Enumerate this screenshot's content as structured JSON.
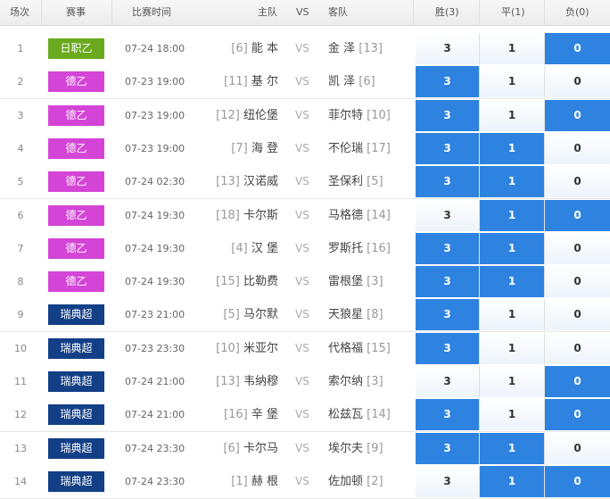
{
  "header": {
    "num": "场次",
    "league": "赛事",
    "time": "比赛时间",
    "home": "主队",
    "vs": "VS",
    "away": "客队",
    "win": "胜(3)",
    "draw": "平(1)",
    "lose": "负(0)"
  },
  "colors": {
    "j2": "#6aaa1e",
    "bundesliga2": "#d444d6",
    "allsvenskan": "#123f86",
    "selected_odd": "#2e83e0"
  },
  "rows": [
    {
      "num": "1",
      "league": "日职乙",
      "league_key": "j2",
      "time": "07-24 18:00",
      "home_rank": "[6]",
      "home": "能 本",
      "vs": "VS",
      "away": "金 泽",
      "away_rank": "[13]",
      "o3": "3",
      "o1": "1",
      "o0": "0",
      "sel": [
        false,
        false,
        true
      ]
    },
    {
      "num": "2",
      "league": "德乙",
      "league_key": "bundesliga2",
      "time": "07-23 19:00",
      "home_rank": "[11]",
      "home": "基 尔",
      "vs": "VS",
      "away": "凯 泽",
      "away_rank": "[6]",
      "o3": "3",
      "o1": "1",
      "o0": "0",
      "sel": [
        true,
        false,
        false
      ]
    },
    {
      "num": "3",
      "league": "德乙",
      "league_key": "bundesliga2",
      "time": "07-23 19:00",
      "home_rank": "[12]",
      "home": "纽伦堡",
      "vs": "VS",
      "away": "菲尔特",
      "away_rank": "[10]",
      "o3": "3",
      "o1": "1",
      "o0": "0",
      "sel": [
        true,
        false,
        true
      ]
    },
    {
      "num": "4",
      "league": "德乙",
      "league_key": "bundesliga2",
      "time": "07-23 19:00",
      "home_rank": "[7]",
      "home": "海 登",
      "vs": "VS",
      "away": "不伦瑞",
      "away_rank": "[17]",
      "o3": "3",
      "o1": "1",
      "o0": "0",
      "sel": [
        true,
        true,
        false
      ]
    },
    {
      "num": "5",
      "league": "德乙",
      "league_key": "bundesliga2",
      "time": "07-24 02:30",
      "home_rank": "[13]",
      "home": "汉诺威",
      "vs": "VS",
      "away": "圣保利",
      "away_rank": "[5]",
      "o3": "3",
      "o1": "1",
      "o0": "0",
      "sel": [
        true,
        true,
        false
      ]
    },
    {
      "num": "6",
      "league": "德乙",
      "league_key": "bundesliga2",
      "time": "07-24 19:30",
      "home_rank": "[18]",
      "home": "卡尔斯",
      "vs": "VS",
      "away": "马格德",
      "away_rank": "[14]",
      "o3": "3",
      "o1": "1",
      "o0": "0",
      "sel": [
        false,
        true,
        true
      ]
    },
    {
      "num": "7",
      "league": "德乙",
      "league_key": "bundesliga2",
      "time": "07-24 19:30",
      "home_rank": "[4]",
      "home": "汉 堡",
      "vs": "VS",
      "away": "罗斯托",
      "away_rank": "[16]",
      "o3": "3",
      "o1": "1",
      "o0": "0",
      "sel": [
        true,
        true,
        false
      ]
    },
    {
      "num": "8",
      "league": "德乙",
      "league_key": "bundesliga2",
      "time": "07-24 19:30",
      "home_rank": "[15]",
      "home": "比勒费",
      "vs": "VS",
      "away": "雷根堡",
      "away_rank": "[3]",
      "o3": "3",
      "o1": "1",
      "o0": "0",
      "sel": [
        true,
        true,
        false
      ]
    },
    {
      "num": "9",
      "league": "瑞典超",
      "league_key": "allsvenskan",
      "time": "07-23 21:00",
      "home_rank": "[5]",
      "home": "马尔默",
      "vs": "VS",
      "away": "天狼星",
      "away_rank": "[8]",
      "o3": "3",
      "o1": "1",
      "o0": "0",
      "sel": [
        true,
        false,
        false
      ]
    },
    {
      "num": "10",
      "league": "瑞典超",
      "league_key": "allsvenskan",
      "time": "07-23 23:30",
      "home_rank": "[10]",
      "home": "米亚尔",
      "vs": "VS",
      "away": "代格福",
      "away_rank": "[15]",
      "o3": "3",
      "o1": "1",
      "o0": "0",
      "sel": [
        true,
        false,
        false
      ]
    },
    {
      "num": "11",
      "league": "瑞典超",
      "league_key": "allsvenskan",
      "time": "07-24 21:00",
      "home_rank": "[13]",
      "home": "韦纳穆",
      "vs": "VS",
      "away": "索尔纳",
      "away_rank": "[3]",
      "o3": "3",
      "o1": "1",
      "o0": "0",
      "sel": [
        false,
        false,
        true
      ]
    },
    {
      "num": "12",
      "league": "瑞典超",
      "league_key": "allsvenskan",
      "time": "07-24 21:00",
      "home_rank": "[16]",
      "home": "辛 堡",
      "vs": "VS",
      "away": "松兹瓦",
      "away_rank": "[14]",
      "o3": "3",
      "o1": "1",
      "o0": "0",
      "sel": [
        true,
        false,
        true
      ]
    },
    {
      "num": "13",
      "league": "瑞典超",
      "league_key": "allsvenskan",
      "time": "07-24 23:30",
      "home_rank": "[6]",
      "home": "卡尔马",
      "vs": "VS",
      "away": "埃尔夫",
      "away_rank": "[9]",
      "o3": "3",
      "o1": "1",
      "o0": "0",
      "sel": [
        true,
        true,
        false
      ]
    },
    {
      "num": "14",
      "league": "瑞典超",
      "league_key": "allsvenskan",
      "time": "07-24 23:30",
      "home_rank": "[1]",
      "home": "赫 根",
      "vs": "VS",
      "away": "佐加顿",
      "away_rank": "[2]",
      "o3": "3",
      "o1": "1",
      "o0": "0",
      "sel": [
        false,
        true,
        true
      ]
    }
  ]
}
